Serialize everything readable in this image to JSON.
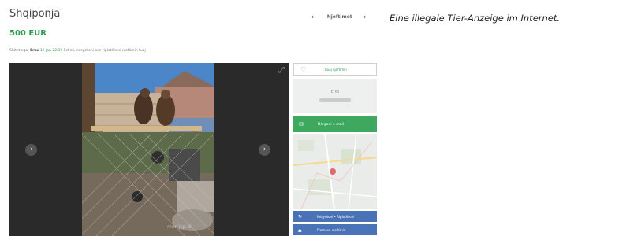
{
  "listing": {
    "title": "Shqiponja",
    "price": "500 EUR",
    "posted_prefix": "Shitet nga:",
    "seller": "Erko",
    "date": "12 Jan 22:39",
    "posted_suffix": "Fshini, ndryshoni ose riplotësoni njoftimin tuaj"
  },
  "nav": {
    "prev_icon": "←",
    "label": "Njoftimet",
    "next_icon": "→"
  },
  "photo": {
    "expand_icon": "⤢",
    "prev_icon": "‹",
    "next_icon": "›",
    "watermark": "merrjep.al"
  },
  "sidebar": {
    "save_label": "Ruaj njoftimin",
    "user_name": "Erko",
    "message_label": "Dërgoni e-mail",
    "edit_label": "Ndryshoni • Riplotësoni",
    "promote_label": "Promovo njoftimin"
  },
  "caption": "Eine illegale Tier-Anzeige im Internet.",
  "colors": {
    "price_green": "#2e9b52",
    "button_green": "#3ea95e",
    "button_blue": "#4a73b7"
  }
}
